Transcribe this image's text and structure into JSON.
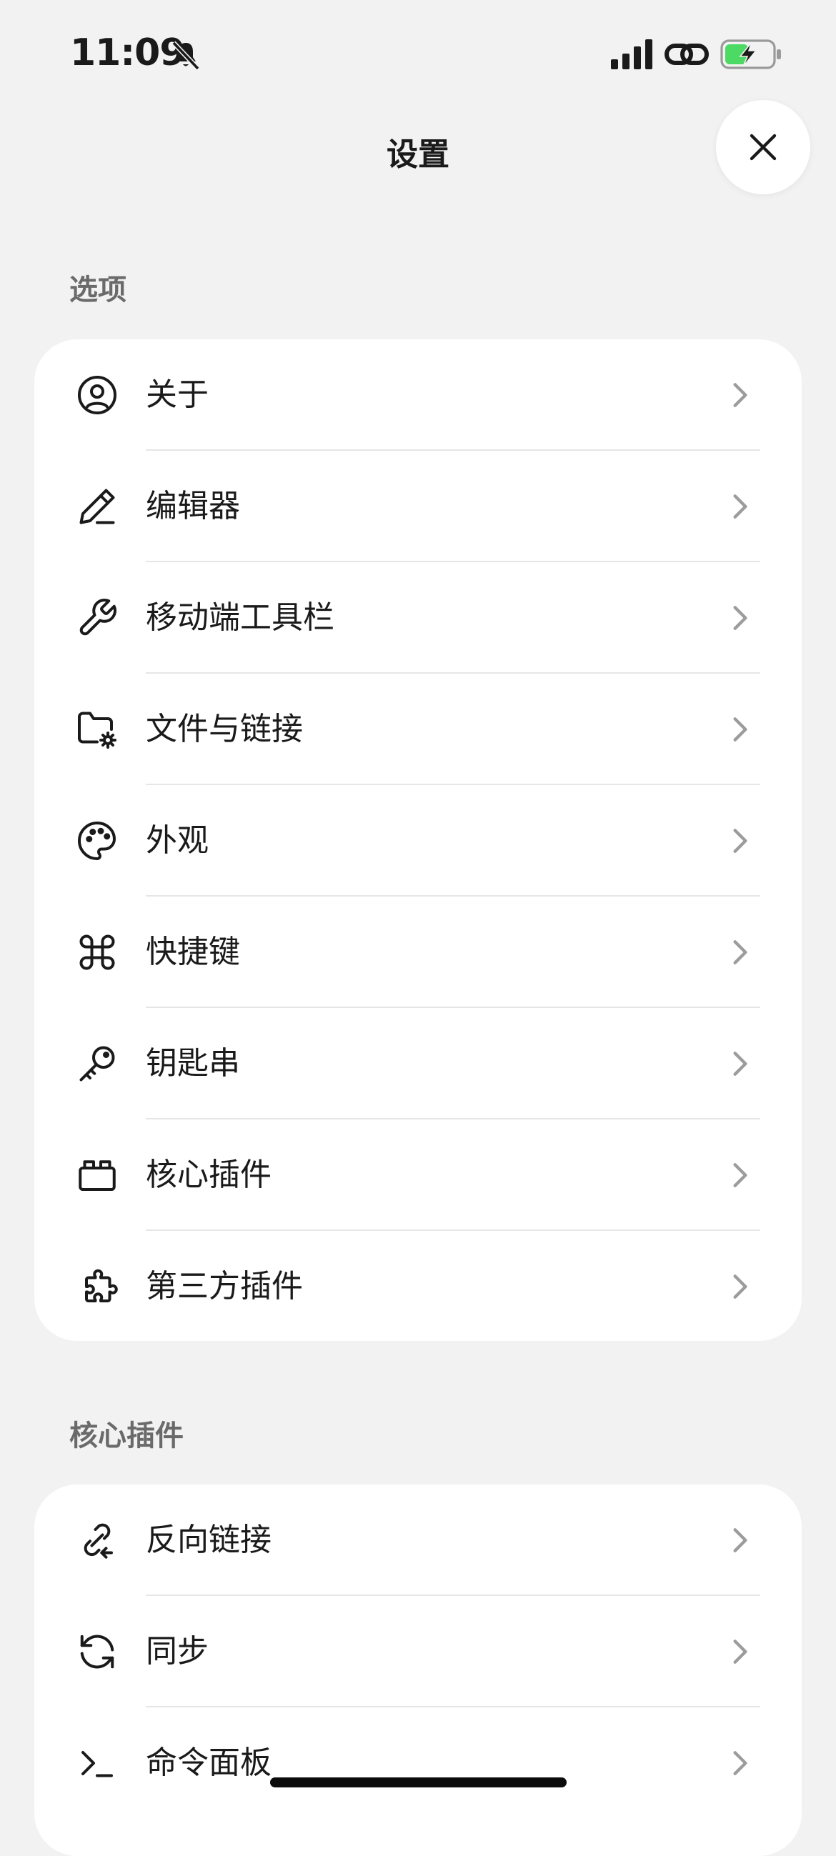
{
  "status_bar": {
    "time": "11:09",
    "icons": [
      "bell-slash-icon",
      "cellular-signal-icon",
      "link-icon",
      "battery-charging-icon"
    ],
    "battery_color": "#4cd964"
  },
  "header": {
    "title": "设置",
    "close_icon": "close-icon"
  },
  "sections": [
    {
      "title": "选项",
      "items": [
        {
          "label": "关于",
          "icon": "user-circle-icon"
        },
        {
          "label": "编辑器",
          "icon": "pencil-icon"
        },
        {
          "label": "移动端工具栏",
          "icon": "wrench-icon"
        },
        {
          "label": "文件与链接",
          "icon": "folder-gear-icon"
        },
        {
          "label": "外观",
          "icon": "palette-icon"
        },
        {
          "label": "快捷键",
          "icon": "command-icon"
        },
        {
          "label": "钥匙串",
          "icon": "key-icon"
        },
        {
          "label": "核心插件",
          "icon": "core-plugin-icon"
        },
        {
          "label": "第三方插件",
          "icon": "puzzle-icon"
        }
      ]
    },
    {
      "title": "核心插件",
      "items": [
        {
          "label": "反向链接",
          "icon": "backlink-icon"
        },
        {
          "label": "同步",
          "icon": "sync-icon"
        },
        {
          "label": "命令面板",
          "icon": "terminal-icon"
        }
      ]
    }
  ],
  "chevron_icon": "chevron-right-icon"
}
